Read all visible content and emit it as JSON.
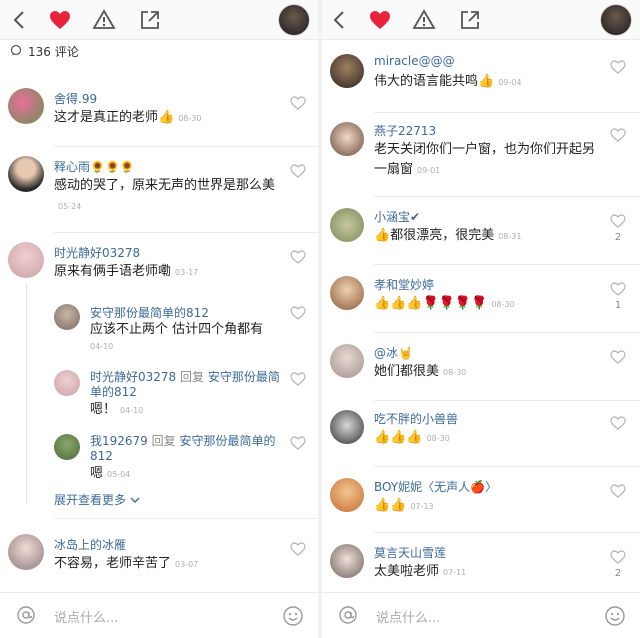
{
  "left": {
    "comment_count": "136 评论",
    "comments": [
      {
        "name": "舍得.99",
        "text": "这才是真正的老师",
        "emoji": "👍",
        "date": "08-30"
      },
      {
        "name": "释心雨🌻🌻🌻",
        "text": "感动的哭了，原来无声的世界是那么美",
        "date": "05-24"
      },
      {
        "name": "时光静好03278",
        "text": "原来有俩手语老师嘞",
        "date": "03-17"
      }
    ],
    "replies": [
      {
        "name": "安守那份最简单的812",
        "text": "应该不止两个  估计四个角都有",
        "date": "04-10"
      },
      {
        "name": "时光静好03278",
        "reply_word": "回复",
        "target": "安守那份最简单的812",
        "text": "嗯！",
        "date": "04-10"
      },
      {
        "name": "我192679",
        "reply_word": "回复",
        "target": "安守那份最简单的812",
        "text": "嗯",
        "date": "05-04"
      }
    ],
    "more_label": "展开查看更多",
    "last": {
      "name": "冰岛上的冰雁",
      "text": "不容易，老师辛苦了",
      "date": "03-07"
    },
    "input_placeholder": "说点什么..."
  },
  "right": {
    "comments": [
      {
        "name": "miracle@@@",
        "text": "伟大的语言能共鸣",
        "emoji": "👍",
        "date": "09-04",
        "likes": ""
      },
      {
        "name": "燕子22713",
        "text": "老天关闭你们一户窗，也为你们开起另一扇窗",
        "date": "09-01",
        "likes": ""
      },
      {
        "name": "小涵宝✔",
        "emoji": "👍",
        "text": "都很漂亮，很完美",
        "date": "08-31",
        "likes": "2"
      },
      {
        "name": "孝和堂妙婷",
        "emoji": "👍👍👍🌹🌹🌹🌹",
        "text": "",
        "date": "08-30",
        "likes": "1"
      },
      {
        "name": "@冰🤘",
        "text": "她们都很美",
        "date": "08-30",
        "likes": ""
      },
      {
        "name": "吃不胖的小兽兽",
        "emoji": "👍👍👍",
        "text": "",
        "date": "08-30",
        "likes": ""
      },
      {
        "name": "BOY妮妮〈无声人🍎〉",
        "emoji": "👍👍",
        "text": "",
        "date": "07-13",
        "likes": ""
      },
      {
        "name": "莫言天山雪莲",
        "text": "太美啦老师",
        "date": "07-11",
        "likes": "2"
      }
    ],
    "input_placeholder": "说点什么..."
  },
  "colors": {
    "heart_red": "#e8243c",
    "name_blue": "#3c6a98"
  }
}
